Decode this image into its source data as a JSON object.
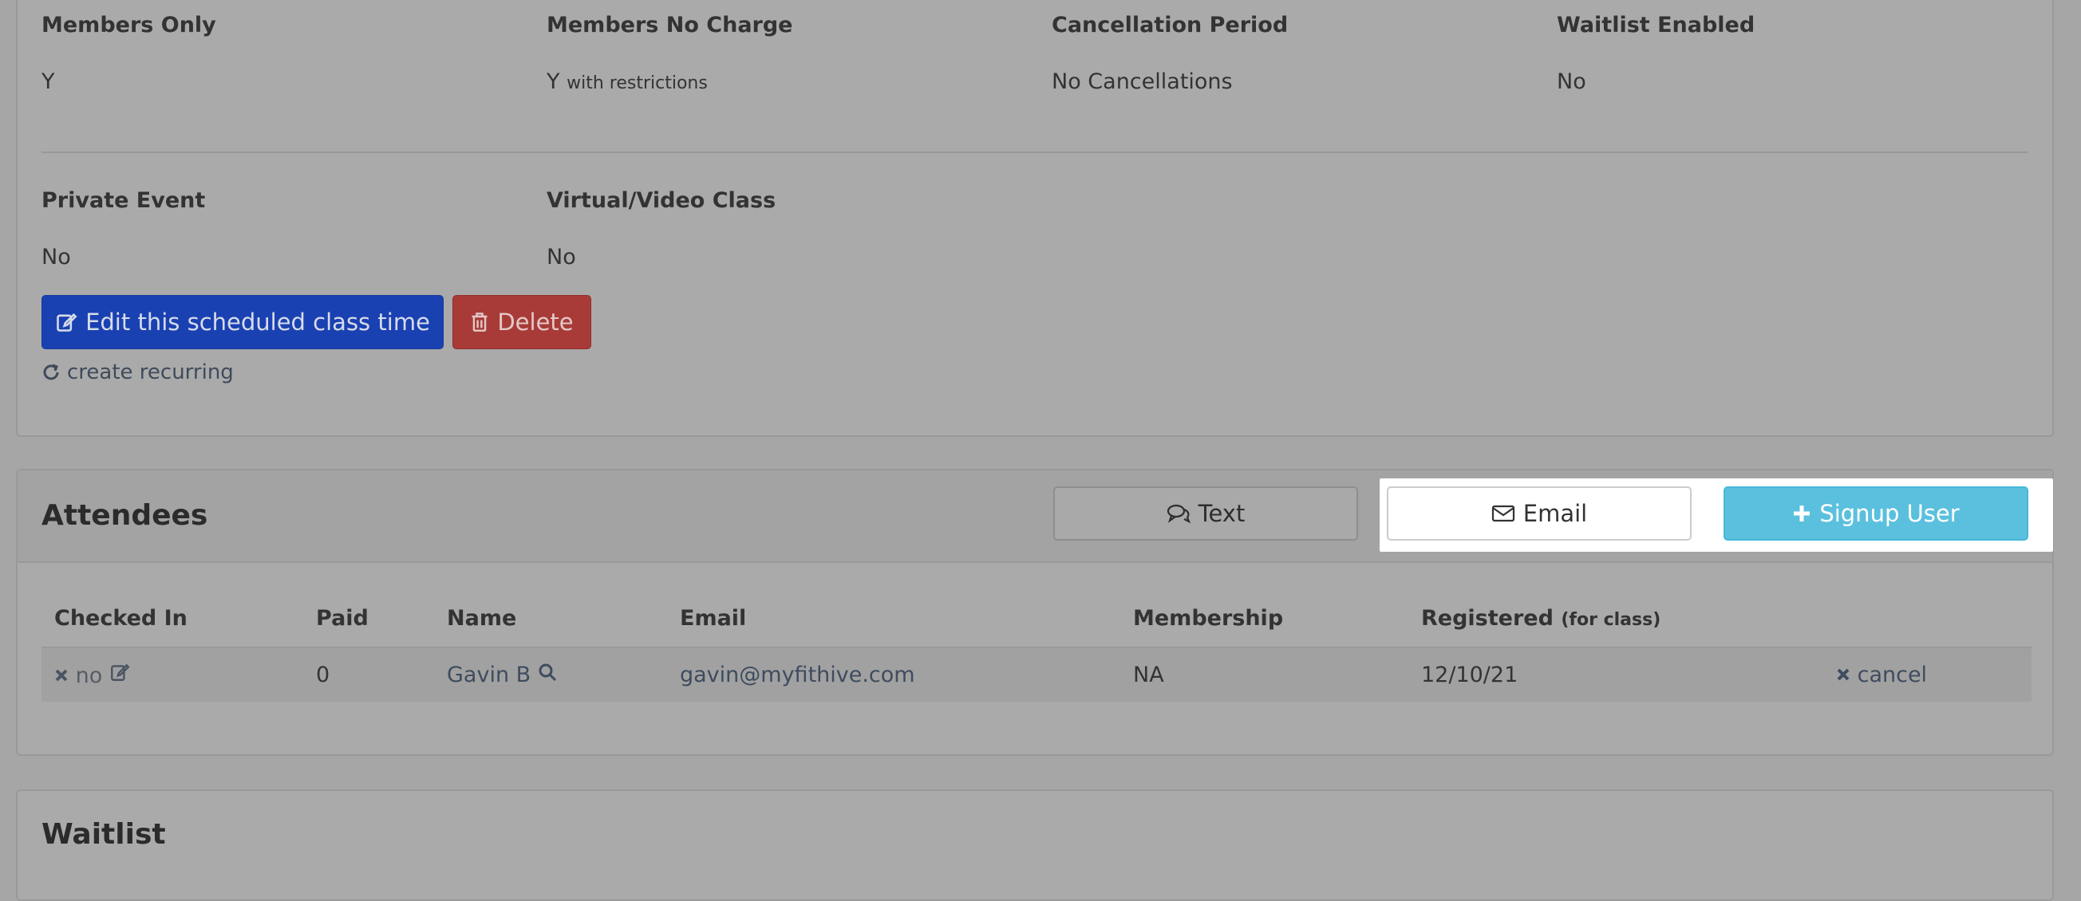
{
  "details": {
    "fields": [
      {
        "label": "Members Only",
        "value": "Y",
        "note": ""
      },
      {
        "label": "Members No Charge",
        "value": "Y",
        "note": "with restrictions"
      },
      {
        "label": "Cancellation Period",
        "value": "No Cancellations",
        "note": ""
      },
      {
        "label": "Waitlist Enabled",
        "value": "No",
        "note": ""
      },
      {
        "label": "Private Event",
        "value": "No",
        "note": ""
      },
      {
        "label": "Virtual/Video Class",
        "value": "No",
        "note": ""
      }
    ],
    "edit_label": "Edit this scheduled class time",
    "delete_label": "Delete",
    "recurring_label": "create recurring"
  },
  "attendees": {
    "title": "Attendees",
    "text_button": "Text",
    "email_button": "Email",
    "signup_button": "Signup User",
    "columns": [
      "Checked In",
      "Paid",
      "Name",
      "Email",
      "Membership",
      "Registered"
    ],
    "registered_note": "(for class)",
    "rows": [
      {
        "checked_in": "no",
        "paid": "0",
        "name": "Gavin B",
        "email": "gavin@myfithive.com",
        "membership": "NA",
        "registered": "12/10/21",
        "action": "cancel"
      }
    ]
  },
  "waitlist": {
    "title": "Waitlist"
  },
  "colors": {
    "primary": "#1a41b2",
    "danger": "#a83b38",
    "info": "#5bc0de"
  }
}
